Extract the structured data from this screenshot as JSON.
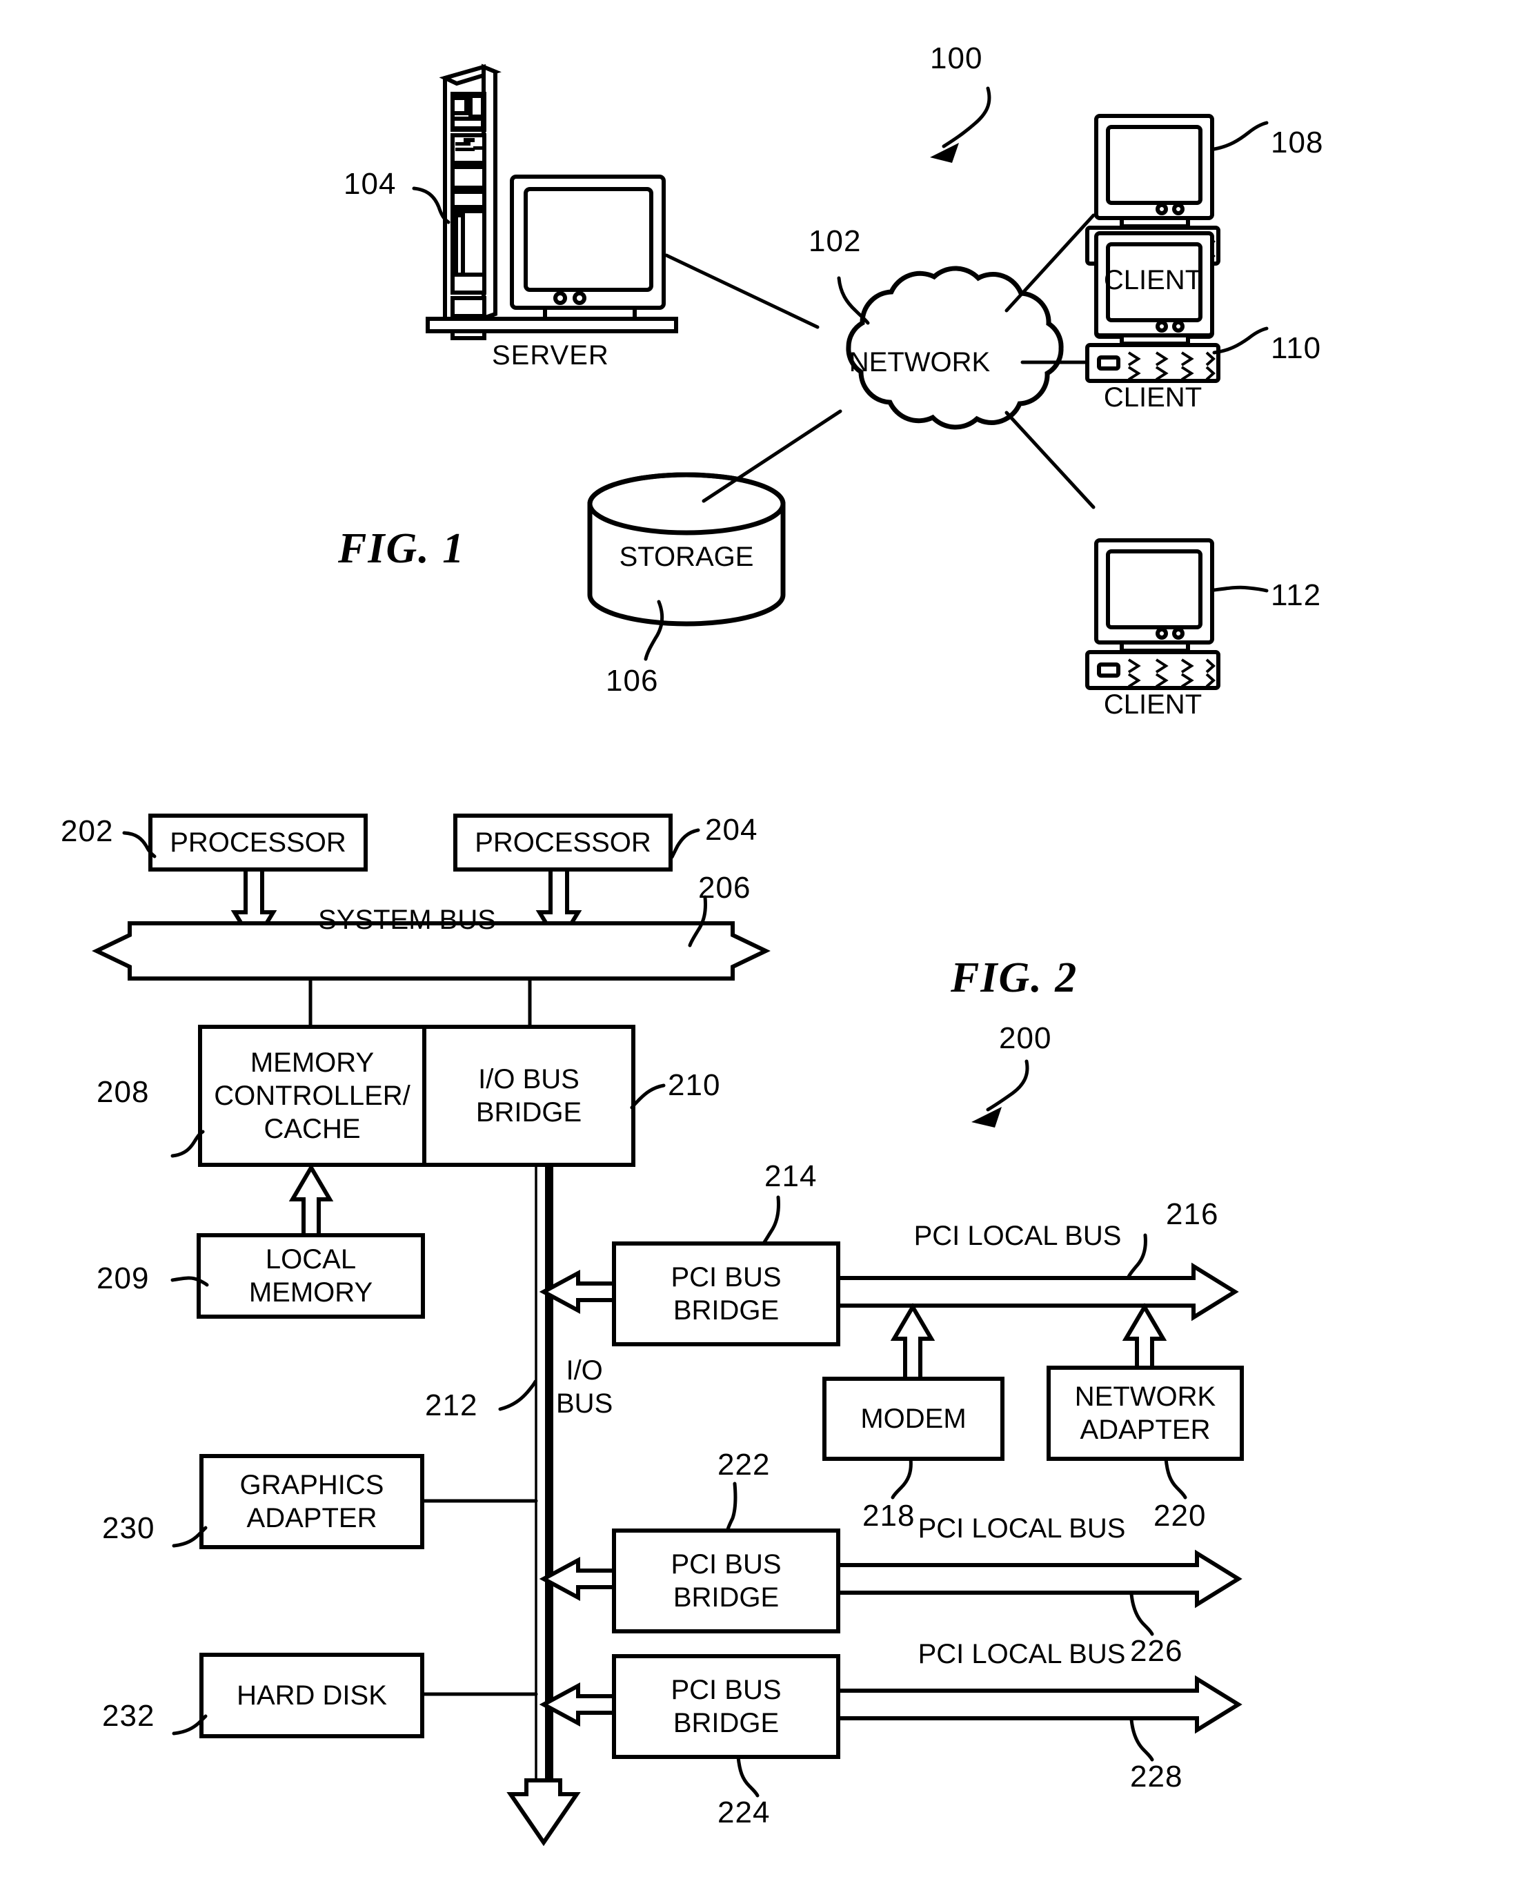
{
  "figure1": {
    "title": "FIG. 1",
    "system_ref": "100",
    "nodes": {
      "server": {
        "label": "SERVER",
        "ref": "104"
      },
      "network": {
        "label": "NETWORK",
        "ref": "102"
      },
      "storage": {
        "label": "STORAGE",
        "ref": "106"
      },
      "client1": {
        "label": "CLIENT",
        "ref": "108"
      },
      "client2": {
        "label": "CLIENT",
        "ref": "110"
      },
      "client3": {
        "label": "CLIENT",
        "ref": "112"
      }
    }
  },
  "figure2": {
    "title": "FIG. 2",
    "system_ref": "200",
    "blocks": {
      "processor1": {
        "label": "PROCESSOR",
        "ref": "202"
      },
      "processor2": {
        "label": "PROCESSOR",
        "ref": "204"
      },
      "system_bus": {
        "label": "SYSTEM BUS",
        "ref": "206"
      },
      "memory_controller": {
        "label": "MEMORY\nCONTROLLER/\nCACHE",
        "ref": "208"
      },
      "io_bus_bridge": {
        "label": "I/O BUS\nBRIDGE",
        "ref": "210"
      },
      "local_memory": {
        "label": "LOCAL\nMEMORY",
        "ref": "209"
      },
      "io_bus": {
        "label": "I/O\nBUS",
        "ref": "212"
      },
      "pci_bridge1": {
        "label": "PCI BUS\nBRIDGE",
        "ref": "214"
      },
      "pci_local_bus1": {
        "label": "PCI LOCAL BUS",
        "ref": "216"
      },
      "modem": {
        "label": "MODEM",
        "ref": "218"
      },
      "network_adapter": {
        "label": "NETWORK\nADAPTER",
        "ref": "220"
      },
      "pci_bridge2": {
        "label": "PCI BUS\nBRIDGE",
        "ref": "222"
      },
      "pci_local_bus2": {
        "label": "PCI LOCAL BUS",
        "ref": "226"
      },
      "pci_bridge3": {
        "label": "PCI BUS\nBRIDGE",
        "ref": "224"
      },
      "pci_local_bus3": {
        "label": "PCI LOCAL BUS",
        "ref": "228"
      },
      "graphics_adapter": {
        "label": "GRAPHICS\nADAPTER",
        "ref": "230"
      },
      "hard_disk": {
        "label": "HARD DISK",
        "ref": "232"
      }
    }
  },
  "colors": {
    "ink": "#000000",
    "paper": "#ffffff"
  }
}
